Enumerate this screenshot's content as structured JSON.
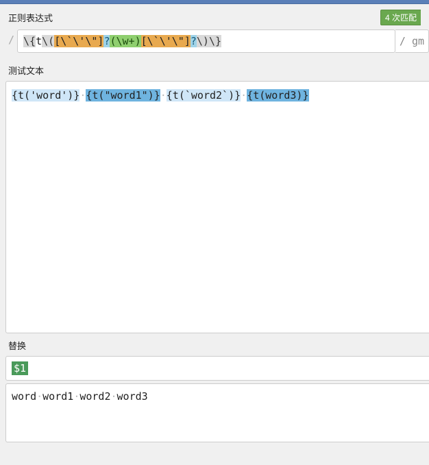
{
  "labels": {
    "regex": "正则表达式",
    "test": "测试文本",
    "replace": "替换"
  },
  "match_badge": "4 次匹配",
  "regex": {
    "t1": "\\{",
    "t2": "t",
    "t3": "\\(",
    "t4": "[\\`\\'\\\"]",
    "t5": "?",
    "t6": "(",
    "t7": "\\w+",
    "t8": ")",
    "t9": "[\\`\\'\\\"]",
    "t10": "?",
    "t11": "\\)",
    "t12": "\\}"
  },
  "flags": "gm",
  "flag_slash": "/",
  "slash": "/",
  "test_text": {
    "m1": "{t('word')}",
    "m2": "{t(\"word1\")}",
    "m3": "{t(`word2`)}",
    "m4": "{t(word3)}",
    "sep": "·"
  },
  "replace_pattern": "$1",
  "result": {
    "w1": "word",
    "w2": "word1",
    "w3": "word2",
    "w4": "word3",
    "sep": "·"
  }
}
